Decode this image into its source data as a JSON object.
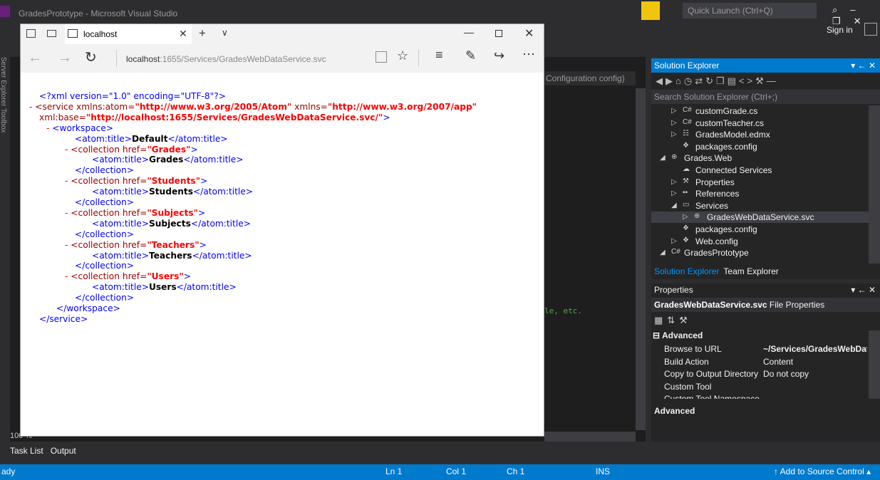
{
  "vs": {
    "title": "GradesPrototype - Microsoft Visual Studio",
    "quick_launch_placeholder": "Quick Launch (Ctrl+Q)",
    "sign_in": "Sign in",
    "left_strip_text": "Server Explorer   Toolbox",
    "editor_tab_text": "Configuration config)",
    "editor_comment": "le, etc.",
    "zoom": "100 %",
    "bottom_tabs": [
      "Task List",
      "Output"
    ],
    "status": {
      "ready": "ady",
      "ln": "Ln 1",
      "col": "Col 1",
      "ch": "Ch 1",
      "ins": "INS",
      "source_control": "Add to Source Control"
    },
    "accent_color": "#007acc"
  },
  "solution_explorer": {
    "title": "Solution Explorer",
    "search_placeholder": "Search Solution Explorer (Ctrl+;)",
    "items": [
      {
        "label": "customGrade.cs",
        "icon": "csharp-icon",
        "arrow": "▷"
      },
      {
        "label": "customTeacher.cs",
        "icon": "csharp-icon",
        "arrow": "▷"
      },
      {
        "label": "GradesModel.edmx",
        "icon": "edmx-icon",
        "arrow": "▷"
      },
      {
        "label": "packages.config",
        "icon": "config-icon",
        "arrow": ""
      },
      {
        "label": "Grades.Web",
        "icon": "web-project-icon",
        "arrow": "◢"
      },
      {
        "label": "Connected Services",
        "icon": "cloud-icon",
        "arrow": ""
      },
      {
        "label": "Properties",
        "icon": "wrench-icon",
        "arrow": "▷"
      },
      {
        "label": "References",
        "icon": "references-icon",
        "arrow": "▷"
      },
      {
        "label": "Services",
        "icon": "folder-icon",
        "arrow": "◢"
      },
      {
        "label": "GradesWebDataService.svc",
        "icon": "service-icon",
        "arrow": "▷"
      },
      {
        "label": "packages.config",
        "icon": "config-icon",
        "arrow": ""
      },
      {
        "label": "Web.config",
        "icon": "config-icon",
        "arrow": "▷"
      },
      {
        "label": "GradesPrototype",
        "icon": "csharp-project-icon",
        "arrow": "◢"
      }
    ],
    "tabs": [
      "Solution Explorer",
      "Team Explorer"
    ]
  },
  "properties": {
    "title": "Properties",
    "selected_name": "GradesWebDataService.svc",
    "selected_type": "File Properties",
    "category": "Advanced",
    "rows": [
      {
        "key": "Browse to URL",
        "value": "~/Services/GradesWebData:"
      },
      {
        "key": "Build Action",
        "value": "Content"
      },
      {
        "key": "Copy to Output Directory",
        "value": "Do not copy"
      },
      {
        "key": "Custom Tool",
        "value": ""
      },
      {
        "key": "Custom Tool Namespace",
        "value": ""
      }
    ],
    "description_title": "Advanced"
  },
  "browser": {
    "tab_title": "localhost",
    "url_host": "localhost",
    "url_rest": ":1655/Services/GradesWebDataService.svc",
    "xml": {
      "decl": "<?xml version=\"1.0\" encoding=\"UTF-8\"?>",
      "service_open_a": "<service xmlns:atom=",
      "service_atom_ns": "\"http://www.w3.org/2005/Atom\"",
      "service_open_b": " xmlns=",
      "service_ns": "\"http://www.w3.org/2007/app\"",
      "service_open_c": "xml:base=",
      "service_base": "\"http://localhost:1655/Services/GradesWebDataService.svc/\"",
      "service_open_end": ">",
      "workspace_open": "<workspace>",
      "atom_title_open": "<atom:title>",
      "atom_title_close": "</atom:title>",
      "workspace_title": "Default",
      "collection_open_a": "<collection href=",
      "collection_close": "</collection>",
      "collections": [
        {
          "href": "\"Grades\"",
          "title": "Grades"
        },
        {
          "href": "\"Students\"",
          "title": "Students"
        },
        {
          "href": "\"Subjects\"",
          "title": "Subjects"
        },
        {
          "href": "\"Teachers\"",
          "title": "Teachers"
        },
        {
          "href": "\"Users\"",
          "title": "Users"
        }
      ],
      "workspace_close": "</workspace>",
      "service_close": "</service>",
      "dash": "-"
    }
  }
}
